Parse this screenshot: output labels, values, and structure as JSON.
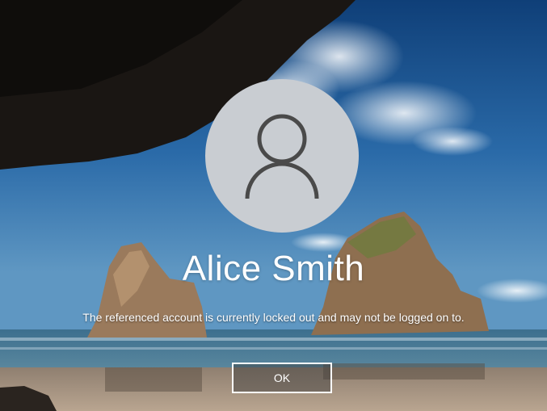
{
  "lock_screen": {
    "user_name": "Alice Smith",
    "message": "The referenced account is currently locked out and may not be logged on to.",
    "ok_label": "OK",
    "avatar_icon": "user-icon"
  },
  "colors": {
    "avatar_bg": "#c9cdd2",
    "avatar_icon": "#4a4a4a",
    "text": "#ffffff"
  }
}
